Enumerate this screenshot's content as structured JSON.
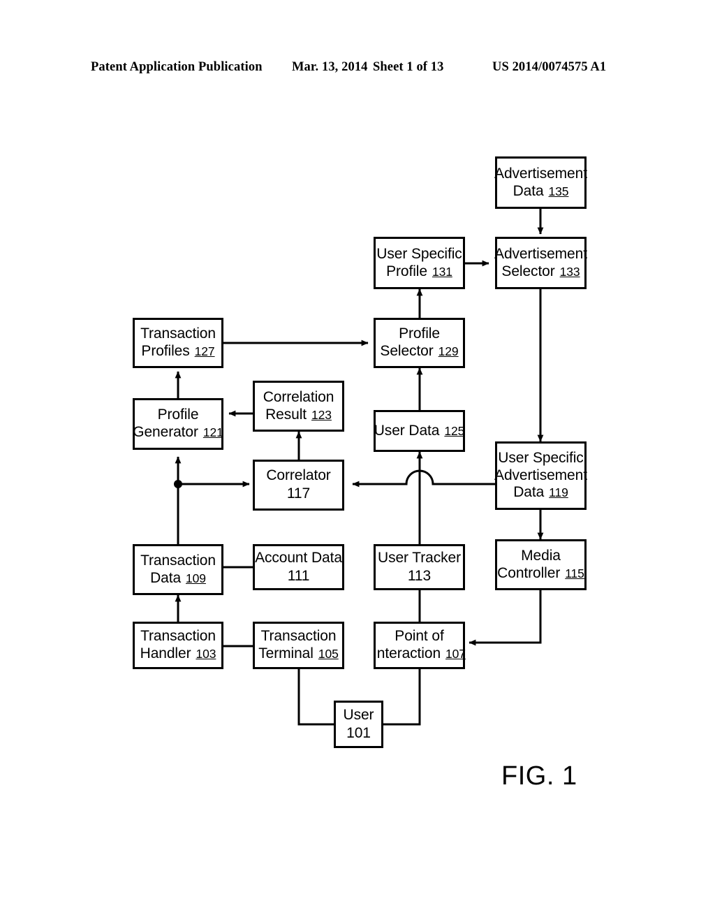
{
  "header": {
    "publication": "Patent Application Publication",
    "date": "Mar. 13, 2014",
    "sheet": "Sheet 1 of 13",
    "patent_number": "US 2014/0074575 A1"
  },
  "figure": {
    "caption": "FIG. 1",
    "type": "block-diagram",
    "line_color": "#000000",
    "background_color": "#ffffff"
  },
  "nodes": [
    {
      "id": "n135",
      "ref": "135",
      "line1": "Advertisement",
      "line2": "Data",
      "ref_inline": true
    },
    {
      "id": "n133",
      "ref": "133",
      "line1": "Advertisement",
      "line2": "Selector",
      "ref_inline": true
    },
    {
      "id": "n131",
      "ref": "131",
      "line1": "User Specific",
      "line2": "Profile",
      "ref_inline": true
    },
    {
      "id": "n129",
      "ref": "129",
      "line1": "Profile",
      "line2": "Selector",
      "ref_inline": true
    },
    {
      "id": "n127",
      "ref": "127",
      "line1": "Transaction",
      "line2": "Profiles",
      "ref_inline": true
    },
    {
      "id": "n125",
      "ref": "125",
      "line1": "User Data",
      "line2": "",
      "ref_inline": true
    },
    {
      "id": "n123",
      "ref": "123",
      "line1": "Correlation",
      "line2": "Result",
      "ref_inline": true
    },
    {
      "id": "n121",
      "ref": "121",
      "line1": "Profile",
      "line2": "Generator",
      "ref_inline": true
    },
    {
      "id": "n119",
      "ref": "119",
      "line1": "User Specific",
      "line2": "Advertisement",
      "line3": "Data",
      "ref_inline": true
    },
    {
      "id": "n117",
      "ref": "117",
      "line1": "Correlator",
      "line2": "",
      "ref_inline": false
    },
    {
      "id": "n115",
      "ref": "115",
      "line1": "Media",
      "line2": "Controller",
      "ref_inline": true
    },
    {
      "id": "n113",
      "ref": "113",
      "line1": "User Tracker",
      "line2": "",
      "ref_inline": false
    },
    {
      "id": "n111",
      "ref": "111",
      "line1": "Account Data",
      "line2": "",
      "ref_inline": false
    },
    {
      "id": "n109",
      "ref": "109",
      "line1": "Transaction",
      "line2": "Data",
      "ref_inline": true
    },
    {
      "id": "n107",
      "ref": "107",
      "line1": "Point of",
      "line2": "Interaction",
      "ref_inline": true
    },
    {
      "id": "n105",
      "ref": "105",
      "line1": "Transaction",
      "line2": "Terminal",
      "ref_inline": true
    },
    {
      "id": "n103",
      "ref": "103",
      "line1": "Transaction",
      "line2": "Handler",
      "ref_inline": true
    },
    {
      "id": "n101",
      "ref": "101",
      "line1": "User",
      "line2": "",
      "ref_inline": false
    }
  ],
  "connections": [
    {
      "from": "135",
      "to": "133",
      "arrow": true
    },
    {
      "from": "131",
      "to": "133",
      "arrow": true
    },
    {
      "from": "129",
      "to": "131",
      "arrow": true
    },
    {
      "from": "127",
      "to": "129",
      "arrow": true
    },
    {
      "from": "125",
      "to": "129",
      "arrow": true
    },
    {
      "from": "123",
      "to": "121",
      "arrow": true
    },
    {
      "from": "121",
      "to": "127",
      "arrow": true
    },
    {
      "from": "117",
      "to": "123",
      "arrow": true
    },
    {
      "from": "109",
      "to": "121",
      "arrow": true
    },
    {
      "from": "109",
      "to": "117",
      "arrow": true
    },
    {
      "from": "119",
      "to": "117",
      "arrow": true
    },
    {
      "from": "133",
      "to": "119",
      "arrow": true
    },
    {
      "from": "119",
      "to": "115",
      "arrow": true
    },
    {
      "from": "113",
      "to": "125",
      "arrow": true
    },
    {
      "from": "115",
      "to": "107",
      "arrow": true
    },
    {
      "from": "103",
      "to": "109",
      "arrow": true
    },
    {
      "from": "109",
      "to": "111",
      "arrow": false
    },
    {
      "from": "103",
      "to": "105",
      "arrow": false
    },
    {
      "from": "105",
      "to": "101",
      "arrow": false
    },
    {
      "from": "101",
      "to": "107",
      "arrow": false
    },
    {
      "from": "107",
      "to": "113",
      "arrow": false
    }
  ]
}
